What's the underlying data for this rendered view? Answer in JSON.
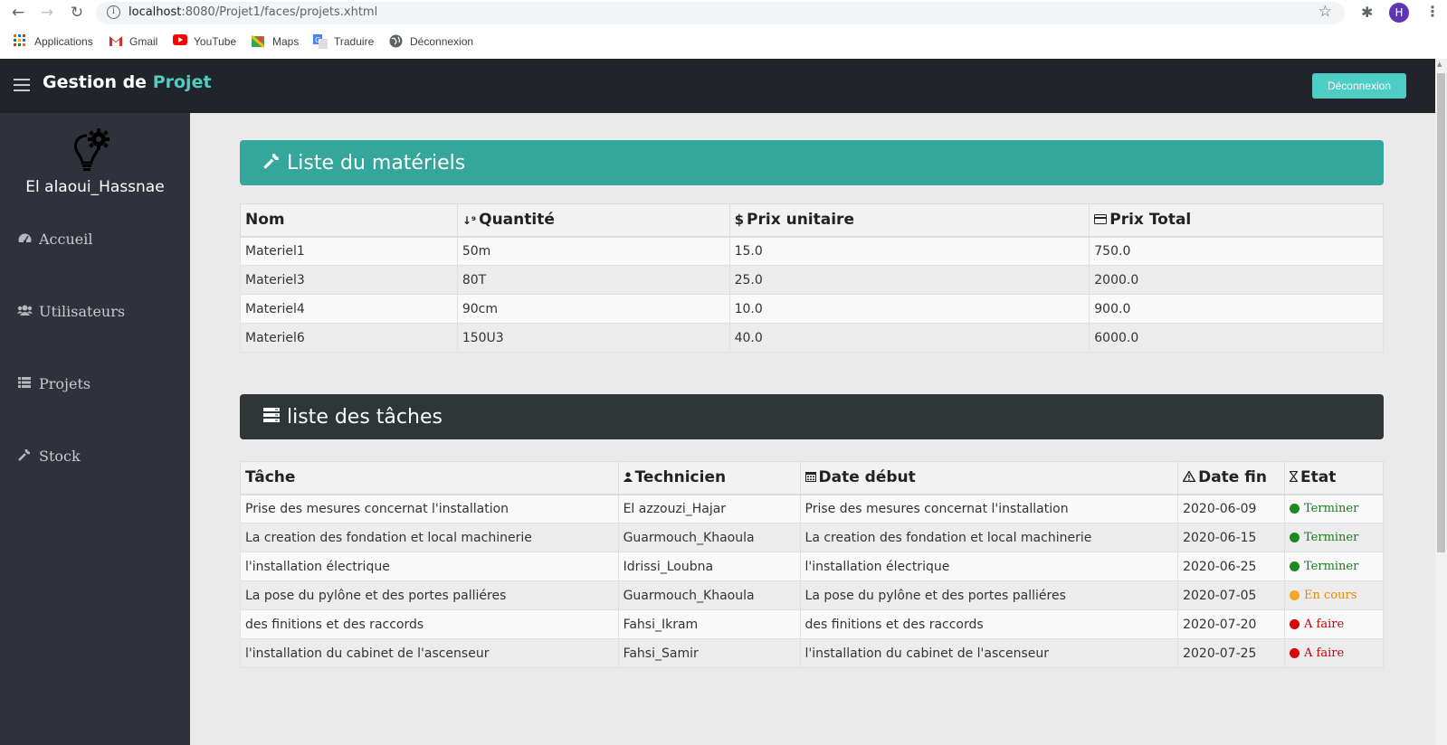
{
  "browser": {
    "url_host": "localhost",
    "url_path": ":8080/Projet1/faces/projets.xhtml",
    "avatar_letter": "H",
    "bookmarks": [
      "Applications",
      "Gmail",
      "YouTube",
      "Maps",
      "Traduire",
      "Déconnexion"
    ]
  },
  "app": {
    "brand_main": "Gestion de",
    "brand_accent": "Projet",
    "logout_label": "Déconnexion",
    "accent_color": "#4ecdc4"
  },
  "sidebar": {
    "user_name": "El alaoui_Hassnae",
    "items": [
      {
        "label": "Accueil",
        "icon": "dashboard-icon"
      },
      {
        "label": "Utilisateurs",
        "icon": "users-icon"
      },
      {
        "label": "Projets",
        "icon": "list-icon"
      },
      {
        "label": "Stock",
        "icon": "wrench-icon"
      }
    ]
  },
  "materials": {
    "title": "Liste du matériels",
    "headers": [
      "Nom",
      "Quantité",
      "Prix unitaire",
      "Prix Total"
    ],
    "rows": [
      [
        "Materiel1",
        "50m",
        "15.0",
        "750.0"
      ],
      [
        "Materiel3",
        "80T",
        "25.0",
        "2000.0"
      ],
      [
        "Materiel4",
        "90cm",
        "10.0",
        "900.0"
      ],
      [
        "Materiel6",
        "150U3",
        "40.0",
        "6000.0"
      ]
    ]
  },
  "tasks": {
    "title": "liste des tâches",
    "headers": [
      "Tâche",
      "Technicien",
      "Date début",
      "Date fin",
      "Etat"
    ],
    "rows": [
      [
        "Prise des mesures concernat l'installation",
        "El azzouzi_Hajar",
        "Prise des mesures concernat l'installation",
        "2020-06-09",
        "Terminer"
      ],
      [
        "La creation des fondation et local machinerie",
        "Guarmouch_Khaoula",
        "La creation des fondation et local machinerie",
        "2020-06-15",
        "Terminer"
      ],
      [
        "l'installation électrique",
        "Idrissi_Loubna",
        "l'installation électrique",
        "2020-06-25",
        "Terminer"
      ],
      [
        "La pose du pylône et des portes palliéres",
        "Guarmouch_Khaoula",
        "La pose du pylône et des portes palliéres",
        "2020-07-05",
        "En cours"
      ],
      [
        "des finitions et des raccords",
        "Fahsi_Ikram",
        "des finitions et des raccords",
        "2020-07-20",
        "A faire"
      ],
      [
        "l'installation du cabinet de l'ascenseur",
        "Fahsi_Samir",
        "l'installation du cabinet de l'ascenseur",
        "2020-07-25",
        "A faire"
      ]
    ],
    "status_colors": {
      "Terminer": "#1a8a1a",
      "En cours": "#f5a623",
      "A faire": "#e00000"
    },
    "status_text_colors": {
      "Terminer": "#1a7a1a",
      "En cours": "#e08a00",
      "A faire": "#cc0000"
    }
  }
}
